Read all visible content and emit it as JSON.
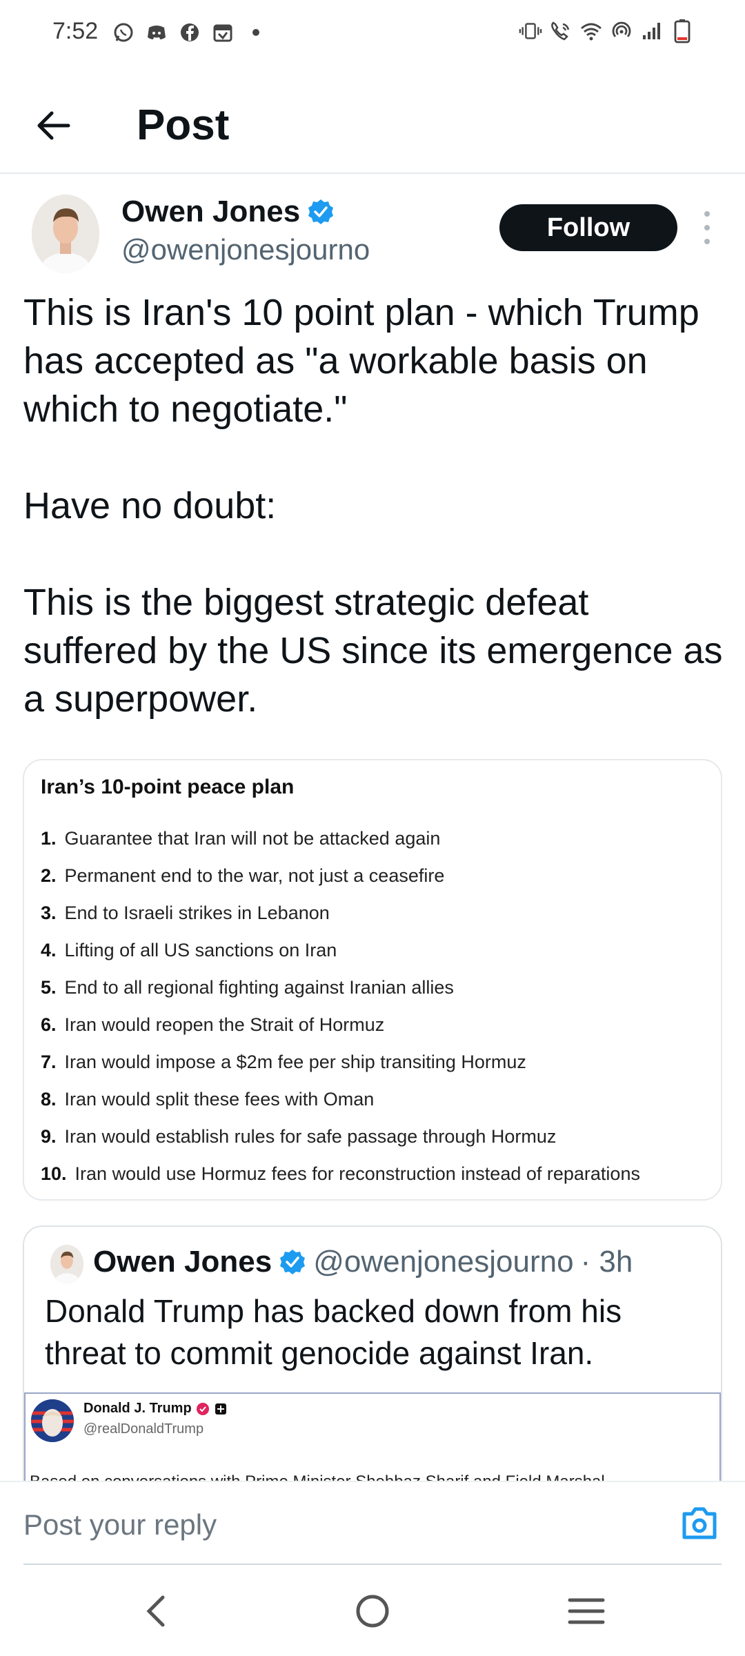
{
  "status_bar": {
    "time": "7:52",
    "left_icons": [
      "whatsapp-icon",
      "discord-icon",
      "facebook-icon",
      "calendar-icon",
      "dot-icon"
    ],
    "right_icons": [
      "vibrate-icon",
      "wifi-calling-icon",
      "wifi-icon",
      "hotspot-icon",
      "signal-icon",
      "battery-icon"
    ]
  },
  "header": {
    "title": "Post"
  },
  "author": {
    "name": "Owen Jones",
    "handle": "@owenjonesjourno",
    "verified": true,
    "follow_label": "Follow"
  },
  "tweet": {
    "paragraphs": [
      "This is Iran's 10 point plan - which Trump has accepted as \"a workable basis on which to negotiate.\"",
      "Have no doubt:",
      "This is the biggest strategic defeat suffered by the US since its emergence as a superpower."
    ]
  },
  "plan_card": {
    "title": "Iran’s 10-point peace plan",
    "items": [
      {
        "num": "1.",
        "text": "Guarantee that Iran will not be attacked again"
      },
      {
        "num": "2.",
        "text": "Permanent end to the war, not just a ceasefire"
      },
      {
        "num": "3.",
        "text": "End to Israeli strikes in Lebanon"
      },
      {
        "num": "4.",
        "text": "Lifting of all US sanctions on Iran"
      },
      {
        "num": "5.",
        "text": "End to all regional fighting against Iranian allies"
      },
      {
        "num": "6.",
        "text": "Iran would reopen the Strait of Hormuz"
      },
      {
        "num": "7.",
        "text": "Iran would impose a $2m fee per ship transiting Hormuz"
      },
      {
        "num": "8.",
        "text": "Iran would split these fees with Oman"
      },
      {
        "num": "9.",
        "text": "Iran would establish rules for safe passage through Hormuz"
      },
      {
        "num": "10.",
        "text": "Iran would use Hormuz fees for reconstruction instead of reparations"
      }
    ]
  },
  "quote": {
    "name": "Owen Jones",
    "handle": "@owenjonesjourno",
    "time": "· 3h",
    "text": "Donald Trump has backed down from his threat to commit genocide against Iran.",
    "embed": {
      "name": "Donald J. Trump",
      "handle": "@realDonaldTrump",
      "text": "Based on conversations with Prime Minister Shehbaz Sharif and Field Marshal"
    }
  },
  "reply": {
    "placeholder": "Post your reply"
  },
  "colors": {
    "verified": "#1d9bf0",
    "accent": "#1d9bf0",
    "text": "#0f1419",
    "muted": "#536471",
    "follow_bg": "#0f1419"
  },
  "nav": [
    "back-nav-icon",
    "home-nav-icon",
    "recents-nav-icon"
  ]
}
